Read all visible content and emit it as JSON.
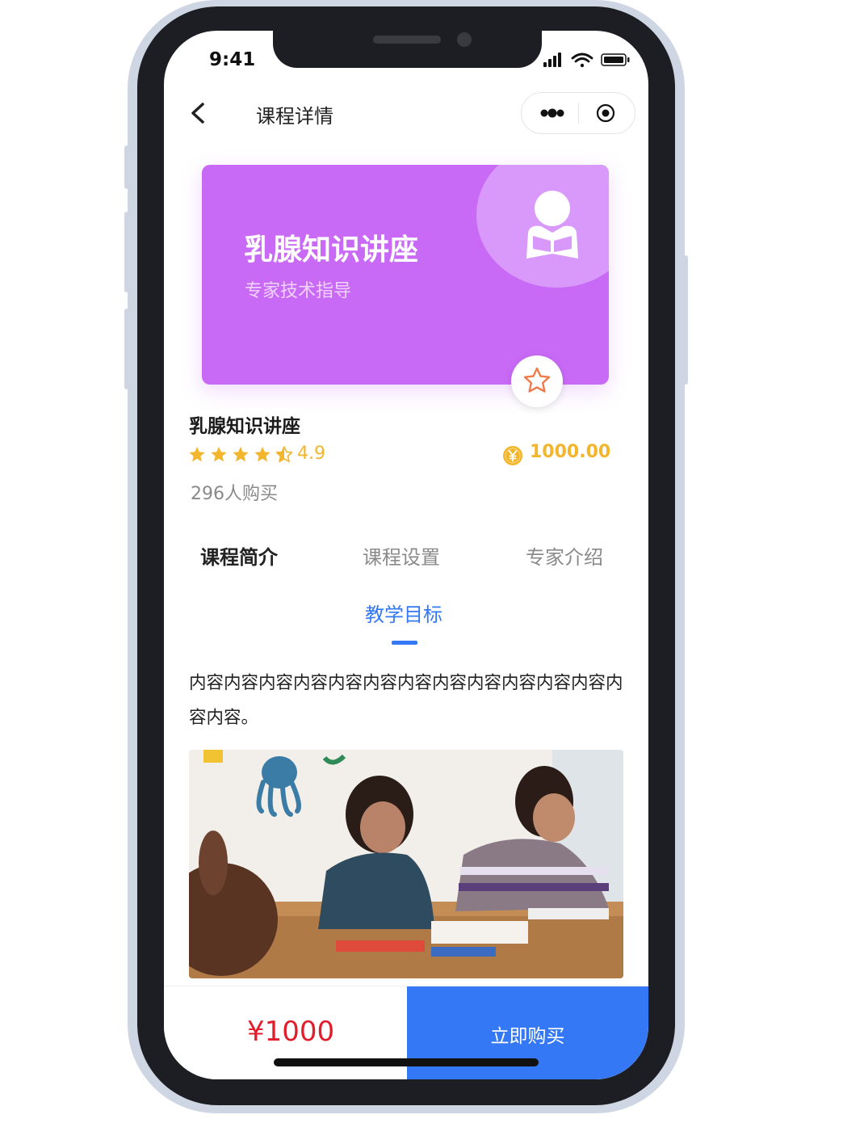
{
  "status_bar": {
    "time": "9:41"
  },
  "nav": {
    "title": "课程详情"
  },
  "banner": {
    "title": "乳腺知识讲座",
    "subtitle": "专家技术指导"
  },
  "course": {
    "name": "乳腺知识讲座",
    "rating": "4.9",
    "rating_value": 4.5,
    "price": "1000.00",
    "buyers": "296人购买"
  },
  "tabs": [
    {
      "label": "课程简介",
      "active": true
    },
    {
      "label": "课程设置",
      "active": false
    },
    {
      "label": "专家介绍",
      "active": false
    }
  ],
  "section": {
    "title": "教学目标",
    "content": "内容内容内容内容内容内容内容内容内容内容内容内容内容内容。"
  },
  "bottom": {
    "price": "¥1000",
    "buy_label": "立即购买"
  },
  "colors": {
    "banner": "#c96af7",
    "accent_blue": "#3478f6",
    "star_gold": "#f3b52b",
    "price_red": "#e31c2b"
  }
}
